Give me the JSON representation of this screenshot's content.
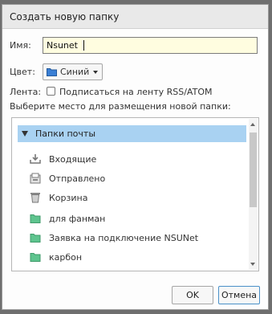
{
  "dialog": {
    "title": "Создать новую папку",
    "name_label": "Имя:",
    "name_value": "Nsunet",
    "color_label": "Цвет:",
    "color_value": "Синий",
    "color_swatch": "#3a7fd5",
    "feed_label": "Лента:",
    "feed_checkbox_label": "Подписаться на ленту RSS/ATOM",
    "feed_checked": false,
    "location_label": "Выберите место для размещения новой папки:",
    "tree": {
      "root": "Папки почты",
      "items": [
        {
          "label": "Входящие",
          "icon": "inbox-icon"
        },
        {
          "label": "Отправлено",
          "icon": "sent-icon"
        },
        {
          "label": "Корзина",
          "icon": "trash-icon"
        },
        {
          "label": "для фанман",
          "icon": "folder-icon"
        },
        {
          "label": "Заявка на подключение NSUNet",
          "icon": "folder-icon"
        },
        {
          "label": "карбон",
          "icon": "folder-icon"
        }
      ]
    },
    "ok_label": "OK",
    "cancel_label": "Отмена"
  }
}
